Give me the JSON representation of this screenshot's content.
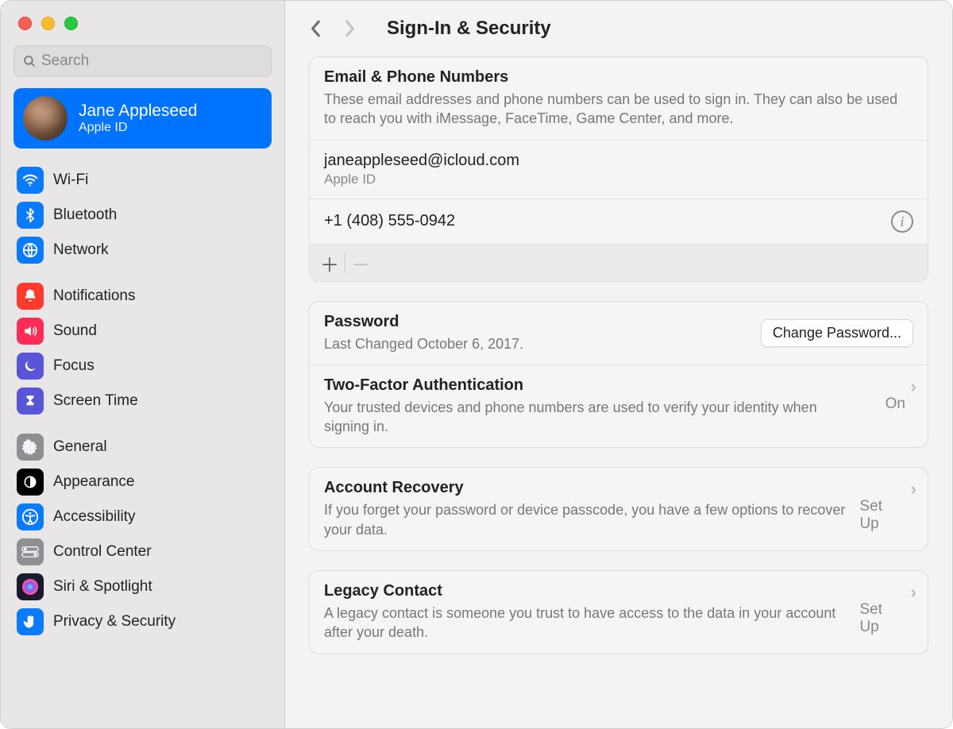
{
  "window": {
    "page_title": "Sign-In & Security"
  },
  "search": {
    "placeholder": "Search"
  },
  "account": {
    "name": "Jane Appleseed",
    "sub": "Apple ID"
  },
  "sidebar": {
    "group1": [
      {
        "label": "Wi-Fi",
        "icon": "wifi-icon"
      },
      {
        "label": "Bluetooth",
        "icon": "bluetooth-icon"
      },
      {
        "label": "Network",
        "icon": "globe-icon"
      }
    ],
    "group2": [
      {
        "label": "Notifications",
        "icon": "bell-icon"
      },
      {
        "label": "Sound",
        "icon": "speaker-icon"
      },
      {
        "label": "Focus",
        "icon": "moon-icon"
      },
      {
        "label": "Screen Time",
        "icon": "hourglass-icon"
      }
    ],
    "group3": [
      {
        "label": "General",
        "icon": "gear-icon"
      },
      {
        "label": "Appearance",
        "icon": "appearance-icon"
      },
      {
        "label": "Accessibility",
        "icon": "accessibility-icon"
      },
      {
        "label": "Control Center",
        "icon": "switches-icon"
      },
      {
        "label": "Siri & Spotlight",
        "icon": "siri-icon"
      },
      {
        "label": "Privacy & Security",
        "icon": "hand-icon"
      }
    ]
  },
  "main": {
    "email_phone": {
      "title": "Email & Phone Numbers",
      "desc": "These email addresses and phone numbers can be used to sign in. They can also be used to reach you with iMessage, FaceTime, Game Center, and more.",
      "entries": [
        {
          "value": "janeappleseed@icloud.com",
          "sub": "Apple ID"
        },
        {
          "value": "+1 (408) 555-0942"
        }
      ]
    },
    "password": {
      "title": "Password",
      "desc": "Last Changed October 6, 2017.",
      "button": "Change Password..."
    },
    "twofa": {
      "title": "Two-Factor Authentication",
      "status": "On",
      "desc": "Your trusted devices and phone numbers are used to verify your identity when signing in."
    },
    "recovery": {
      "title": "Account Recovery",
      "status": "Set Up",
      "desc": "If you forget your password or device passcode, you have a few options to recover your data."
    },
    "legacy": {
      "title": "Legacy Contact",
      "status": "Set Up",
      "desc": "A legacy contact is someone you trust to have access to the data in your account after your death."
    }
  }
}
